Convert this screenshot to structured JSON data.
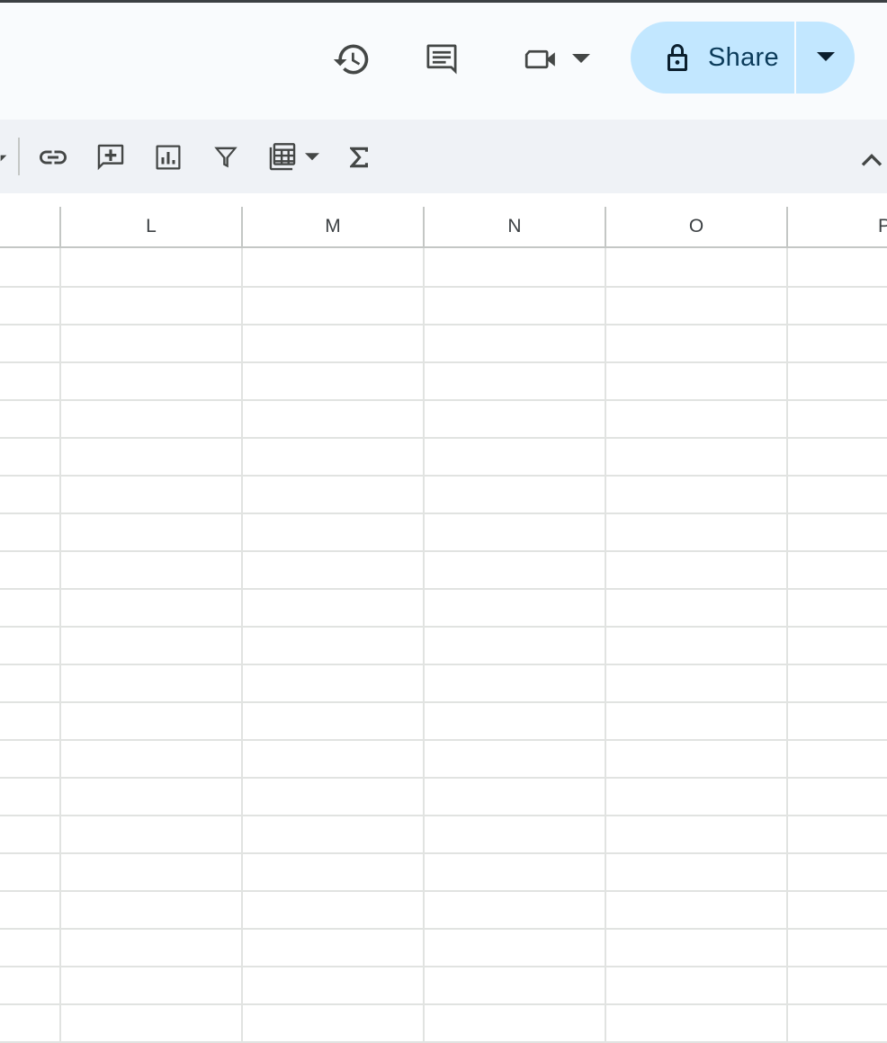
{
  "header": {
    "share_label": "Share",
    "icons": [
      "version-history-icon",
      "comments-icon",
      "meet-icon",
      "lock-icon"
    ]
  },
  "toolbar": {
    "icons": [
      "insert-link-icon",
      "insert-comment-icon",
      "insert-chart-icon",
      "filter-icon",
      "filter-views-icon",
      "functions-icon",
      "collapse-toolbar-icon"
    ]
  },
  "columns": [
    "L",
    "M",
    "N",
    "O",
    "P"
  ],
  "colors": {
    "share_bg": "#c2e7ff",
    "share_text": "#0b3b5a",
    "header_bg": "#f9fbfd",
    "toolbar_bg": "#eff2f6",
    "gridline": "#e1e3e1"
  }
}
